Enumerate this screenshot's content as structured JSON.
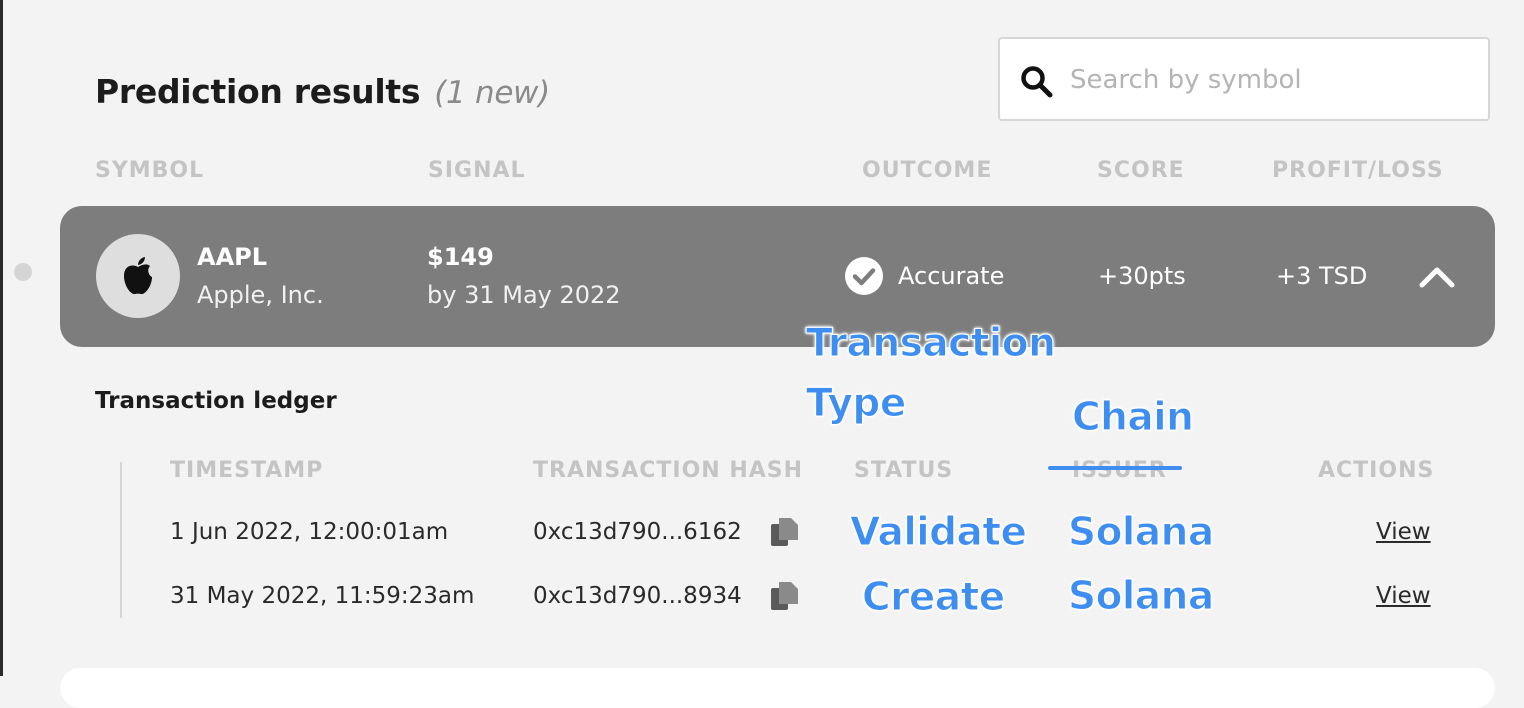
{
  "header": {
    "title": "Prediction results",
    "new_count": "(1 new)"
  },
  "search": {
    "placeholder": "Search by symbol",
    "value": ""
  },
  "columns": [
    "SYMBOL",
    "SIGNAL",
    "OUTCOME",
    "SCORE",
    "PROFIT/LOSS"
  ],
  "result": {
    "symbol": "AAPL",
    "company": "Apple, Inc.",
    "price": "$149",
    "deadline": "by 31 May 2022",
    "outcome": "Accurate",
    "score": "+30pts",
    "profit_loss": "+3 TSD",
    "logo_icon": "apple-logo-icon"
  },
  "ledger": {
    "title": "Transaction ledger",
    "columns": [
      "TIMESTAMP",
      "TRANSACTION HASH",
      "STATUS",
      "ISSUER",
      "ACTIONS"
    ],
    "rows": [
      {
        "timestamp": "1 Jun 2022, 12:00:01am",
        "hash": "0xc13d790...6162",
        "action": "View"
      },
      {
        "timestamp": "31 May 2022, 11:59:23am",
        "hash": "0xc13d790...8934",
        "action": "View"
      }
    ]
  },
  "annotations": {
    "transaction_type_1": "Transaction",
    "transaction_type_2": "Type",
    "chain": "Chain",
    "row1_type": "Validate",
    "row1_chain": "Solana",
    "row2_type": "Create",
    "row2_chain": "Solana"
  },
  "colors": {
    "row_background": "#7d7d7d",
    "annotation_blue": "#3e8ef1",
    "page_background": "#f3f3f3"
  }
}
